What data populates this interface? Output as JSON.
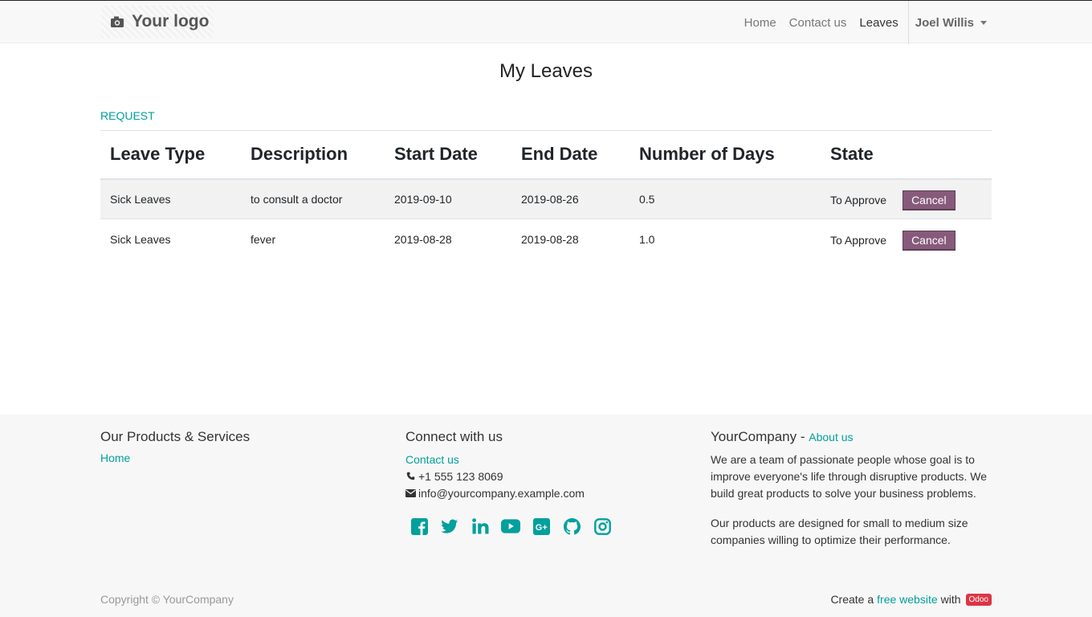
{
  "header": {
    "logo_text": "Your logo",
    "nav": [
      {
        "label": "Home"
      },
      {
        "label": "Contact us"
      },
      {
        "label": "Leaves"
      }
    ],
    "user_name": "Joel Willis"
  },
  "page": {
    "title": "My Leaves",
    "request_label": "REQUEST"
  },
  "table": {
    "columns": [
      "Leave Type",
      "Description",
      "Start Date",
      "End Date",
      "Number of Days",
      "State"
    ],
    "rows": [
      {
        "leave_type": "Sick Leaves",
        "description": "to consult a doctor",
        "start_date": "2019-09-10",
        "end_date": "2019-08-26",
        "days": "0.5",
        "state": "To Approve",
        "action": "Cancel"
      },
      {
        "leave_type": "Sick Leaves",
        "description": "fever",
        "start_date": "2019-08-28",
        "end_date": "2019-08-28",
        "days": "1.0",
        "state": "To Approve",
        "action": "Cancel"
      }
    ]
  },
  "footer": {
    "products": {
      "title": "Our Products & Services",
      "link": "Home"
    },
    "connect": {
      "title": "Connect with us",
      "link": "Contact us",
      "phone": "+1 555 123 8069",
      "email": "info@yourcompany.example.com",
      "social_icons": [
        "facebook-icon",
        "twitter-icon",
        "linkedin-icon",
        "youtube-icon",
        "google-plus-icon",
        "github-icon",
        "instagram-icon"
      ]
    },
    "about": {
      "company": "YourCompany",
      "separator": "-",
      "link": "About us",
      "paragraph1": "We are a team of passionate people whose goal is to improve everyone's life through disruptive products. We build great products to solve your business problems.",
      "paragraph2": "Our products are designed for small to medium size companies willing to optimize their performance."
    },
    "copyright": "Copyright © YourCompany",
    "powered_prefix": "Create a",
    "powered_link": "free website",
    "powered_with": "with",
    "odoo_badge": "Odoo"
  },
  "colors": {
    "accent": "#00a09d",
    "button": "#875a7b",
    "badge": "#dc3545"
  }
}
